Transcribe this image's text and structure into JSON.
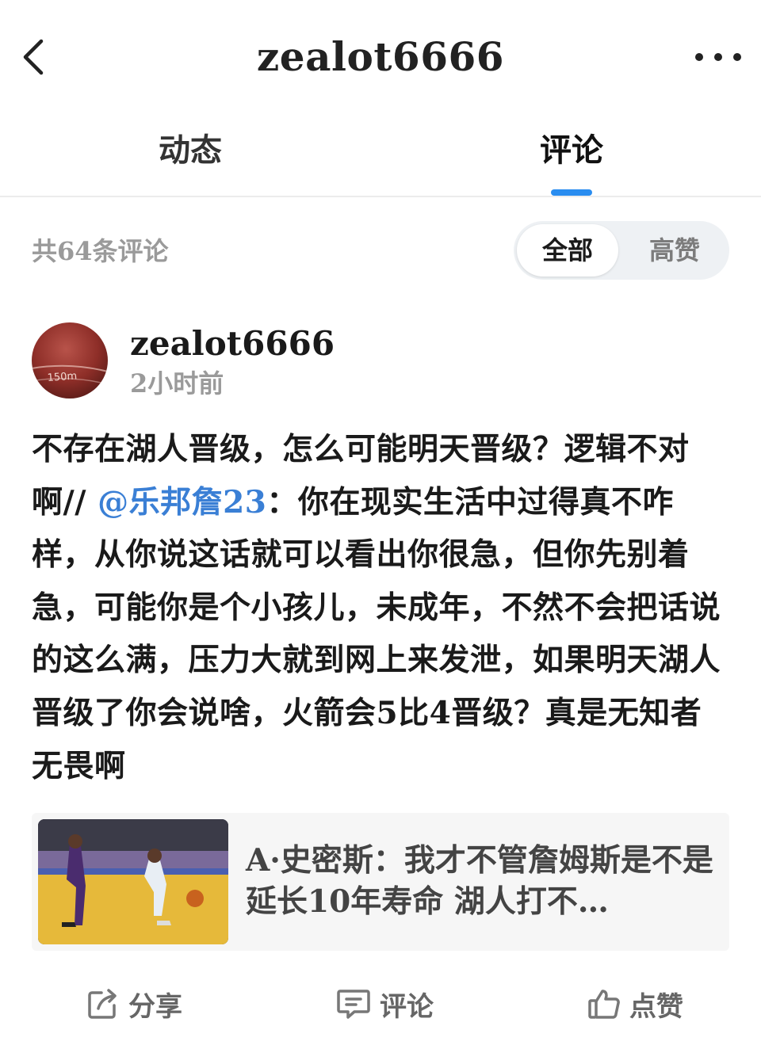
{
  "header": {
    "title": "zealot6666"
  },
  "tabs": [
    {
      "label": "动态"
    },
    {
      "label": "评论"
    }
  ],
  "comments_section": {
    "count_label": "共64条评论",
    "filters": [
      {
        "label": "全部"
      },
      {
        "label": "高赞"
      }
    ]
  },
  "comment": {
    "username": "zealot6666",
    "time": "2小时前",
    "avatar_text": "150m",
    "text_before_mention": "不存在湖人晋级，怎么可能明天晋级？逻辑不对啊// ",
    "mention": "@乐邦詹23",
    "text_after_mention": "：你在现实生活中过得真不咋样，从你说这话就可以看出你很急，但你先别着急，可能你是个小孩儿，未成年，不然不会把话说的这么满，压力大就到网上来发泄，如果明天湖人晋级了你会说啥，火箭会5比4晋级？真是无知者无畏啊"
  },
  "article": {
    "title": "A·史密斯：我才不管詹姆斯是不是延长10年寿命 湖人打不…"
  },
  "actions": [
    {
      "label": "分享",
      "icon": "share-icon"
    },
    {
      "label": "评论",
      "icon": "comment-icon"
    },
    {
      "label": "点赞",
      "icon": "thumbs-up-icon"
    }
  ],
  "colors": {
    "accent": "#2a8df0",
    "mention": "#3a7fd5"
  }
}
